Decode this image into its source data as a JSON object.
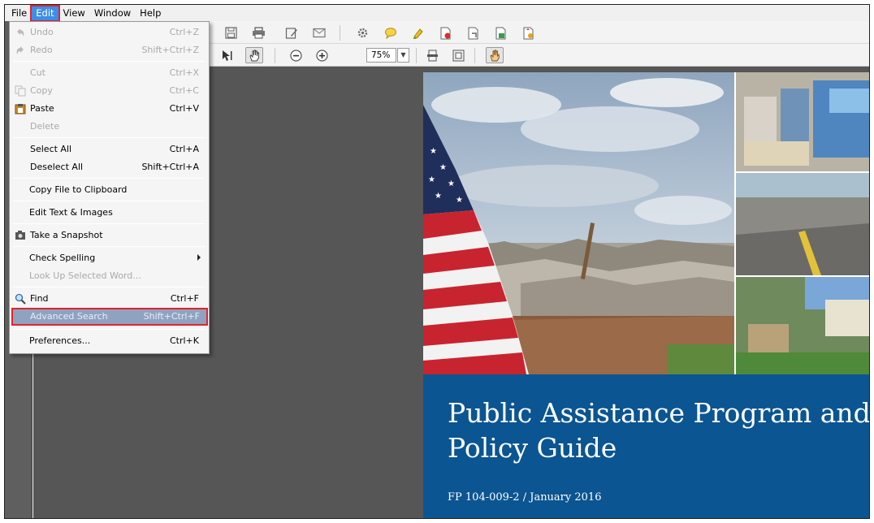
{
  "menubar": {
    "items": [
      "File",
      "Edit",
      "View",
      "Window",
      "Help"
    ],
    "active": "Edit"
  },
  "edit_menu": {
    "items": [
      {
        "label": "Undo",
        "shortcut": "Ctrl+Z",
        "disabled": true
      },
      {
        "label": "Redo",
        "shortcut": "Shift+Ctrl+Z",
        "disabled": true
      },
      {
        "label": "Cut",
        "shortcut": "Ctrl+X",
        "disabled": true
      },
      {
        "label": "Copy",
        "shortcut": "Ctrl+C",
        "disabled": true
      },
      {
        "label": "Paste",
        "shortcut": "Ctrl+V",
        "disabled": false
      },
      {
        "label": "Delete",
        "shortcut": "",
        "disabled": true
      },
      {
        "label": "Select All",
        "shortcut": "Ctrl+A",
        "disabled": false
      },
      {
        "label": "Deselect All",
        "shortcut": "Shift+Ctrl+A",
        "disabled": false
      },
      {
        "label": "Copy File to Clipboard",
        "shortcut": "",
        "disabled": false
      },
      {
        "label": "Edit Text & Images",
        "shortcut": "",
        "disabled": false
      },
      {
        "label": "Take a Snapshot",
        "shortcut": "",
        "disabled": false
      },
      {
        "label": "Check Spelling",
        "shortcut": "",
        "disabled": false
      },
      {
        "label": "Look Up Selected Word...",
        "shortcut": "",
        "disabled": true
      },
      {
        "label": "Find",
        "shortcut": "Ctrl+F",
        "disabled": false
      },
      {
        "label": "Advanced Search",
        "shortcut": "Shift+Ctrl+F",
        "disabled": false,
        "highlighted": true
      },
      {
        "label": "Preferences...",
        "shortcut": "Ctrl+K",
        "disabled": false
      }
    ]
  },
  "toolbar": {
    "zoom": "75%"
  },
  "document": {
    "title": "Public Assistance Program and Policy Guide",
    "subtitle": "FP 104-009-2 / January 2016",
    "banner_color": "#0b5592"
  },
  "colors": {
    "menu_active": "#3d8ee8",
    "highlight_box": "#e0242c",
    "workspace": "#565656"
  }
}
